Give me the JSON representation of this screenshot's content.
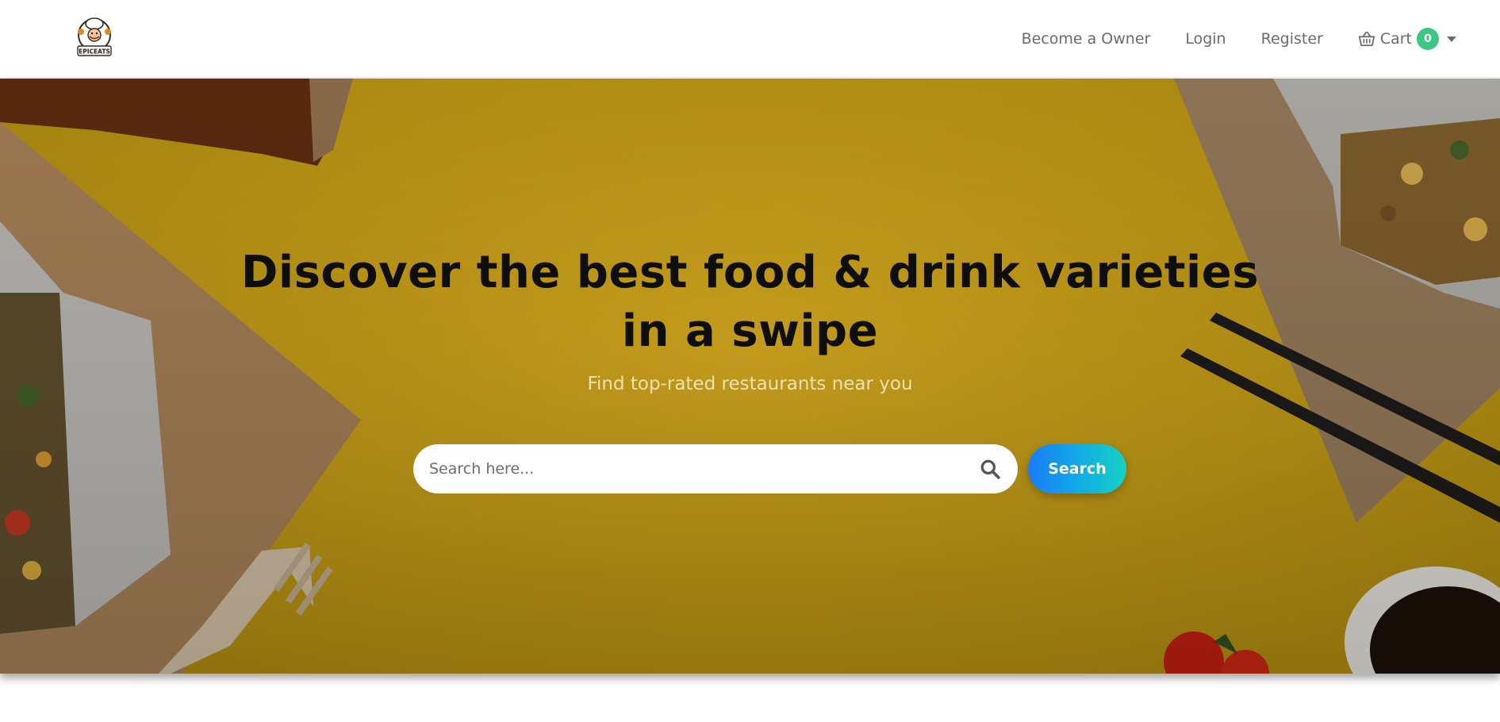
{
  "brand": {
    "logo_text": "EPICEATS",
    "logo_icon": "chef-logo-icon"
  },
  "nav": {
    "links": [
      "Become a Owner",
      "Login",
      "Register"
    ],
    "cart": {
      "label": "Cart",
      "count": "0",
      "icon": "basket-icon",
      "badge_color": "#3ec686"
    }
  },
  "hero": {
    "title_line1": "Discover the best food & drink varieties",
    "title_line2": "in a swipe",
    "subtitle": "Find top-rated restaurants near you",
    "search": {
      "placeholder": "Search here...",
      "value": "",
      "icon": "search-icon",
      "button_label": "Search"
    },
    "background_color": "#b8921a"
  }
}
